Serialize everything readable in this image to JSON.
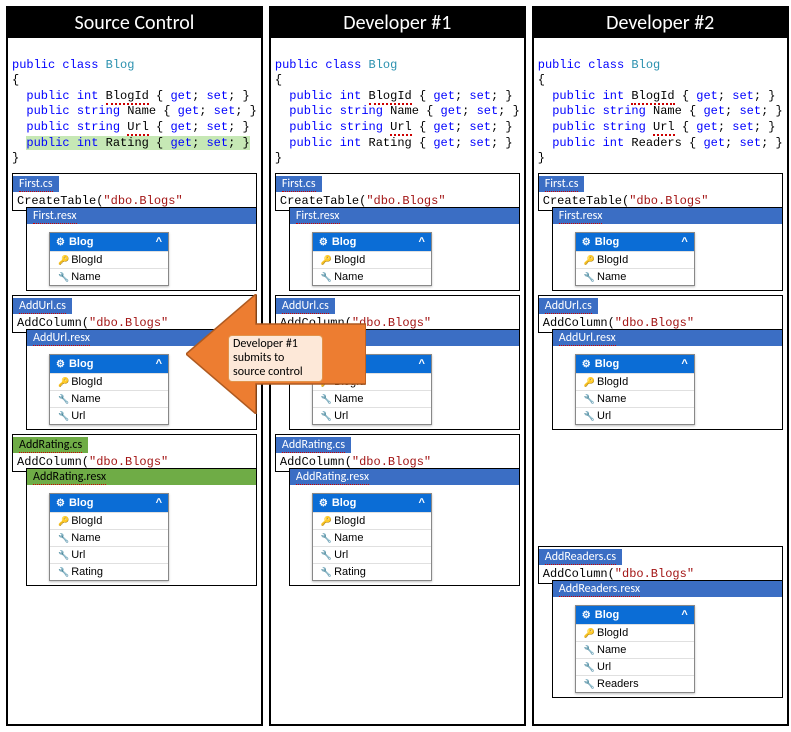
{
  "headers": {
    "source": "Source Control",
    "dev1": "Developer #1",
    "dev2": "Developer #2"
  },
  "code": {
    "class_decl_pre": "public class ",
    "class_name": "Blog",
    "open": "{",
    "blogid": "  public int BlogId { get; set; }",
    "name": "  public string Name { get; set; }",
    "url": "  public string Url { get; set; }",
    "rating": "  public int Rating { get; set; }",
    "readers": "  public int Readers { get; set; }",
    "close": "}"
  },
  "files": {
    "first_cs": "First.cs",
    "first_body": "CreateTable(\"dbo.Blogs\"",
    "first_resx": "First.resx",
    "addurl_cs": "AddUrl.cs",
    "addurl_body": "AddColumn(\"dbo.Blogs\"",
    "addurl_resx": "AddUrl.resx",
    "addrating_cs": "AddRating.cs",
    "addrating_body": "AddColumn(\"dbo.Blogs\"",
    "addrating_resx": "AddRating.resx",
    "addreaders_cs": "AddReaders.cs",
    "addreaders_body": "AddColumn(\"dbo.Blogs\"",
    "addreaders_resx": "AddReaders.resx"
  },
  "entity": {
    "name": "Blog",
    "blogid": "BlogId",
    "name_field": "Name",
    "url": "Url",
    "rating": "Rating",
    "readers": "Readers"
  },
  "arrow": {
    "caption": "Developer #1 submits to source control"
  },
  "icons": {
    "share": "⚙",
    "chevron": "^",
    "key": "🔑",
    "wrench": "🔧"
  }
}
